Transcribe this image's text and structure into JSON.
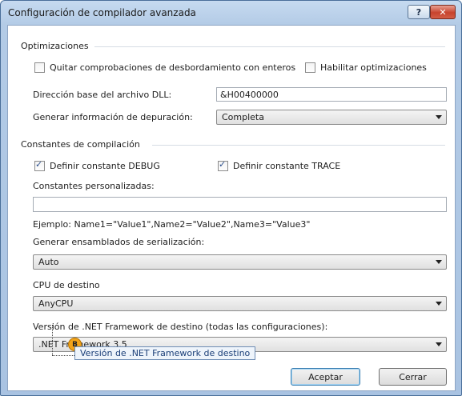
{
  "window": {
    "title": "Configuración de compilador avanzada",
    "help_label": "?",
    "close_label": "✕"
  },
  "optimizations": {
    "group_label": "Optimizaciones",
    "remove_overflow_label": "Quitar comprobaciones de desbordamiento con enteros",
    "remove_overflow_checked": false,
    "enable_opt_label": "Habilitar optimizaciones",
    "enable_opt_checked": false,
    "dll_base_label": "Dirección base del archivo DLL:",
    "dll_base_value": "&H00400000",
    "debug_info_label": "Generar información de depuración:",
    "debug_info_value": "Completa"
  },
  "constants": {
    "group_label": "Constantes de compilación",
    "debug_label": "Definir constante DEBUG",
    "debug_checked": true,
    "trace_label": "Definir constante TRACE",
    "trace_checked": true,
    "custom_label": "Constantes personalizadas:",
    "custom_value": "",
    "example_text": "Ejemplo: Name1=\"Value1\",Name2=\"Value2\",Name3=\"Value3\""
  },
  "serialization": {
    "label": "Generar ensamblados de serialización:",
    "value": "Auto"
  },
  "target_cpu": {
    "label": "CPU de destino",
    "value": "AnyCPU"
  },
  "framework": {
    "label": "Versión de .NET Framework de destino (todas las configuraciones):",
    "value": ".NET Framework 3.5"
  },
  "callout": {
    "badge": "B",
    "text": "Versión de .NET Framework de destino"
  },
  "buttons": {
    "ok": "Aceptar",
    "cancel": "Cerrar"
  },
  "colors": {
    "title_gradient_top": "#c6daf0",
    "close_button": "#c7432d",
    "callout_badge": "#f2a41a",
    "check_mark": "#2c4f8c"
  }
}
